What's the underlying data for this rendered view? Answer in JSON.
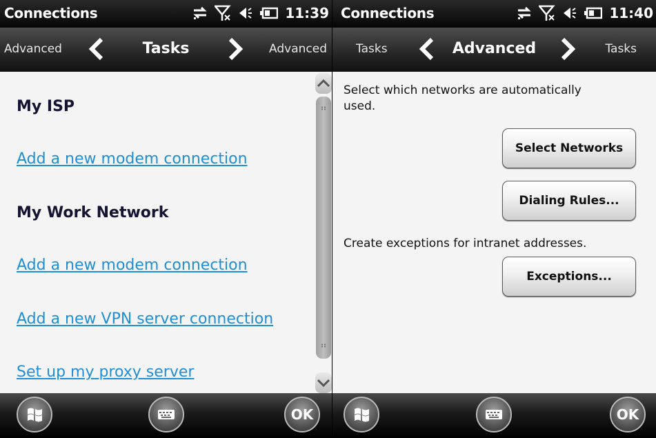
{
  "screens": [
    {
      "status": {
        "title": "Connections",
        "time": "11:39"
      },
      "nav": {
        "prev": "Advanced",
        "current": "Tasks",
        "next": "Advanced"
      },
      "sections": [
        {
          "heading": "My ISP",
          "links": [
            "Add a new modem connection"
          ]
        },
        {
          "heading": "My Work Network",
          "links": [
            "Add a new modem connection",
            "Add a new VPN server connection",
            "Set up my proxy server"
          ]
        }
      ],
      "softkeys": {
        "right": "OK"
      }
    },
    {
      "status": {
        "title": "Connections",
        "time": "11:40"
      },
      "nav": {
        "prev": "Tasks",
        "current": "Advanced",
        "next": "Tasks"
      },
      "networks_text": "Select which networks are automatically used.",
      "select_networks_button": "Select Networks",
      "dialing_rules_button": "Dialing Rules...",
      "exceptions_text": "Create exceptions for intranet addresses.",
      "exceptions_button": "Exceptions...",
      "softkeys": {
        "right": "OK"
      }
    }
  ],
  "icons": {
    "status": [
      "data-connection-icon",
      "no-signal-icon",
      "volume-icon",
      "battery-icon"
    ],
    "bottom": [
      "start-icon",
      "keyboard-icon"
    ]
  }
}
